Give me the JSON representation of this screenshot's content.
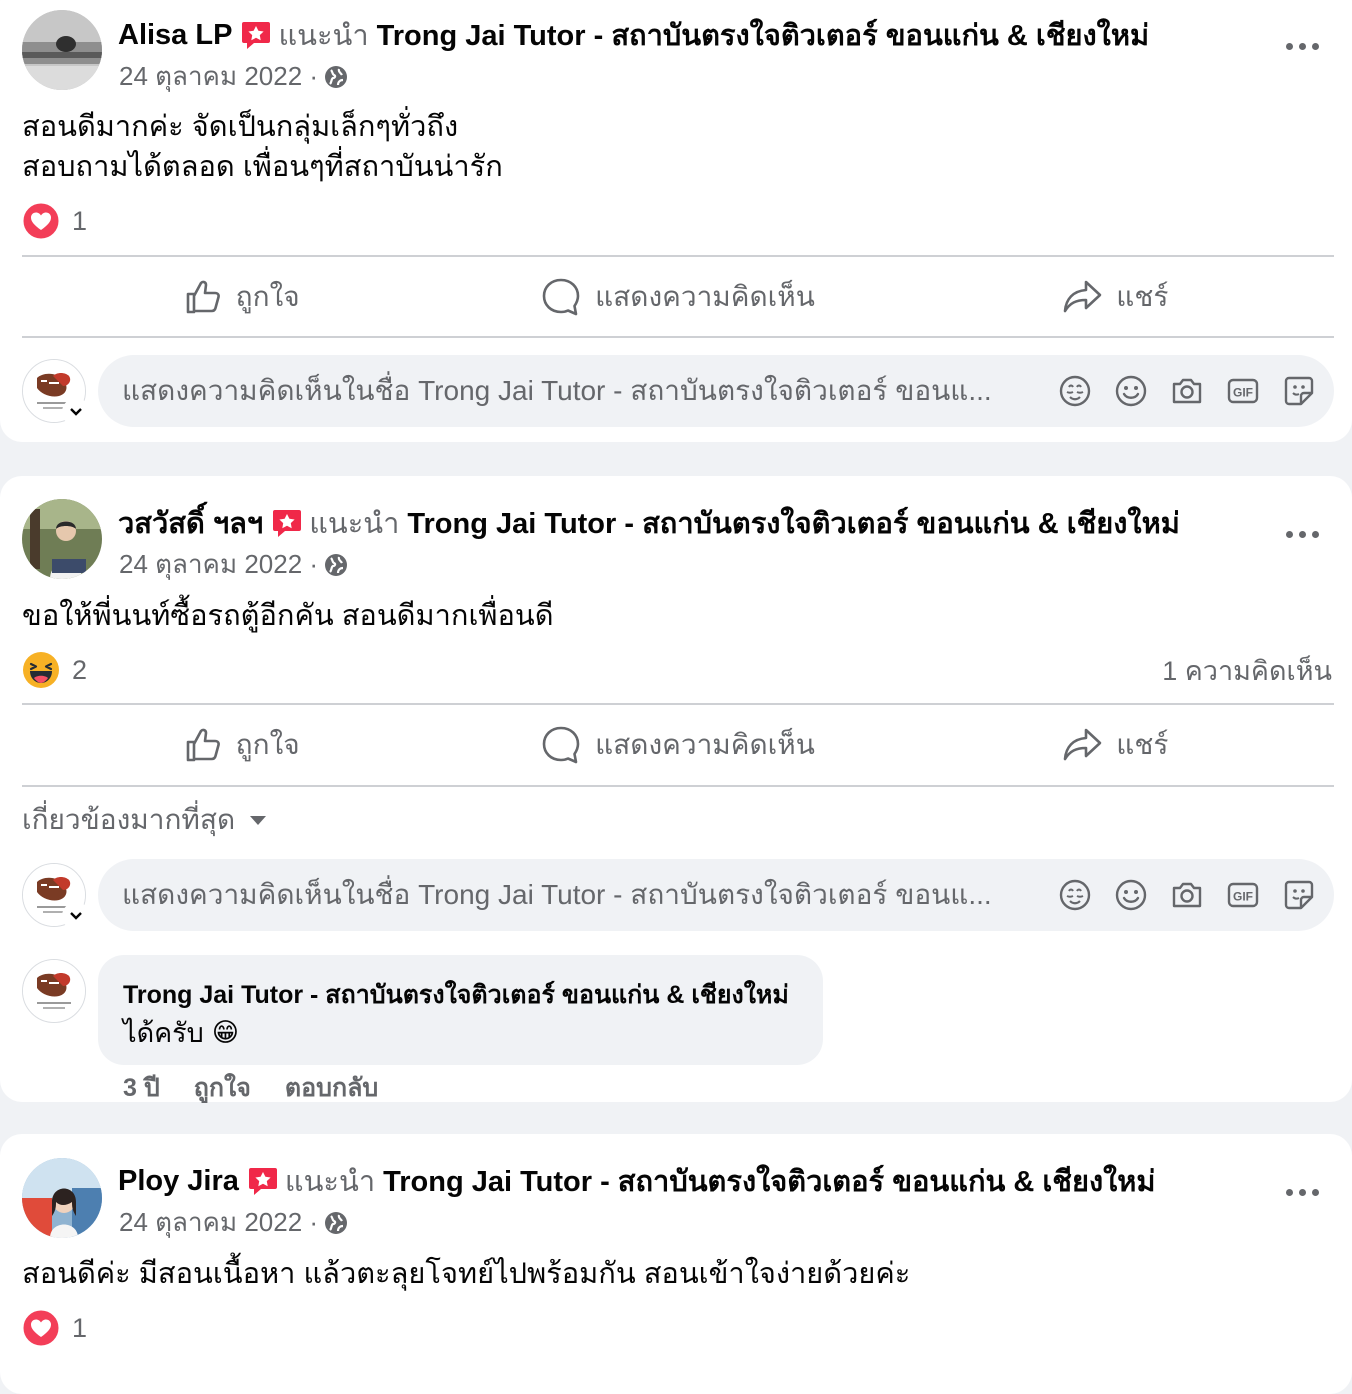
{
  "common": {
    "recommends": "แนะนำ",
    "page_name": "Trong Jai Tutor - สถาบันตรงใจติวเตอร์ ขอนแก่น & เชียงใหม่",
    "like": "ถูกใจ",
    "comment": "แสดงความคิดเห็น",
    "share": "แชร์",
    "comment_placeholder": "แสดงความคิดเห็นในชื่อ Trong Jai Tutor - สถาบันตรงใจติวเตอร์ ขอนแ...",
    "colors": {
      "reaction_red": "#f33e58",
      "haha_yellow": "#f7b125",
      "muted": "#65676b",
      "badge_pink": "#f02849"
    }
  },
  "posts": [
    {
      "author": "Alisa LP",
      "date": "24 ตุลาคม 2022 ·",
      "text_lines": [
        "สอนดีมากค่ะ จัดเป็นกลุ่มเล็กๆทั่วถึง",
        "สอบถามได้ตลอด เพื่อนๆที่สถาบันน่ารัก"
      ],
      "reaction_icon": "love-icon",
      "reaction_count": "1"
    },
    {
      "author": "วสวัสดิ์ ฯลฯ",
      "date": "24 ตุลาคม 2022 ·",
      "text_lines": [
        "ขอให้พี่นนท์ซื้อรถตู้อีกคัน สอนดีมากเพื่อนดี"
      ],
      "reaction_icon": "haha-icon",
      "reaction_count": "2",
      "comment_count": "1 ความคิดเห็น",
      "sort_label": "เกี่ยวข้องมากที่สุด",
      "reply": {
        "author": "Trong Jai Tutor - สถาบันตรงใจติวเตอร์ ขอนแก่น & เชียงใหม่",
        "text": "ได้ครับ",
        "emoji": "😁",
        "age": "3 ปี",
        "like": "ถูกใจ",
        "reply_label": "ตอบกลับ"
      }
    },
    {
      "author": "Ploy Jira",
      "date": "24 ตุลาคม 2022 ·",
      "text_lines": [
        "สอนดีค่ะ มีสอนเนื้อหา แล้วตะลุยโจทย์ไปพร้อมกัน สอนเข้าใจง่ายด้วยค่ะ"
      ],
      "reaction_icon": "love-icon",
      "reaction_count": "1"
    }
  ]
}
